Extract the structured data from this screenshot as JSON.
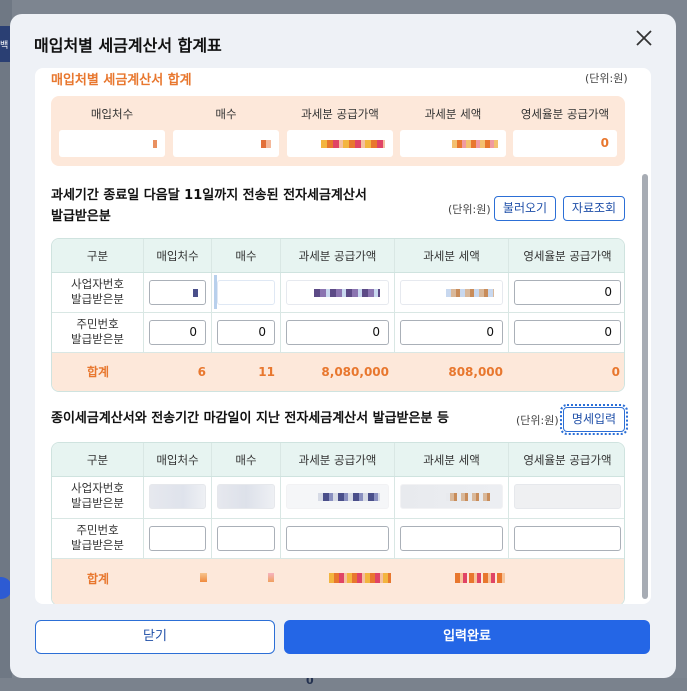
{
  "backdrop": {
    "side_tab": "백",
    "bottom_value": "0"
  },
  "modal": {
    "title": "매입처별 세금계산서 합계표"
  },
  "summary": {
    "title": "매입처별 세금계산서 합계",
    "unit": "(단위:원)",
    "headers": [
      "매입처수",
      "매수",
      "과세분 공급가액",
      "과세분 세액",
      "영세율분 공급가액"
    ],
    "zero_rate_value": "0"
  },
  "section2": {
    "title_line1": "과세기간 종료일 다음달 11일까지 전송된 전자세금계산서",
    "title_line2": "발급받은분",
    "unit": "(단위:원)",
    "load_button": "불러오기",
    "lookup_button": "자료조회",
    "headers": [
      "구분",
      "매입처수",
      "매수",
      "과세분 공급가액",
      "과세분 세액",
      "영세율분 공급가액"
    ],
    "row1_label_1": "사업자번호",
    "row1_label_2": "발급받은분",
    "row1_zero_rate": "0",
    "row2_label_1": "주민번호",
    "row2_label_2": "발급받은분",
    "row2_values": [
      "0",
      "0",
      "0",
      "0",
      "0"
    ],
    "total_label": "합계",
    "total_values": [
      "6",
      "11",
      "8,080,000",
      "808,000",
      "0"
    ]
  },
  "section3": {
    "title": "종이세금계산서와 전송기간 마감일이 지난 전자세금계산서 발급받은분 등",
    "unit": "(단위:원)",
    "detail_button": "명세입력",
    "headers": [
      "구분",
      "매입처수",
      "매수",
      "과세분 공급가액",
      "과세분 세액",
      "영세율분 공급가액"
    ],
    "row1_label_1": "사업자번호",
    "row1_label_2": "발급받은분",
    "row2_label_1": "주민번호",
    "row2_label_2": "발급받은분",
    "total_label": "합계"
  },
  "footer": {
    "close_label": "닫기",
    "done_label": "입력완료"
  },
  "colors": {
    "accent_orange": "#e8772e",
    "primary_blue": "#2466e6",
    "header_teal": "#e7f4f1",
    "summary_bg": "#fde8da"
  }
}
